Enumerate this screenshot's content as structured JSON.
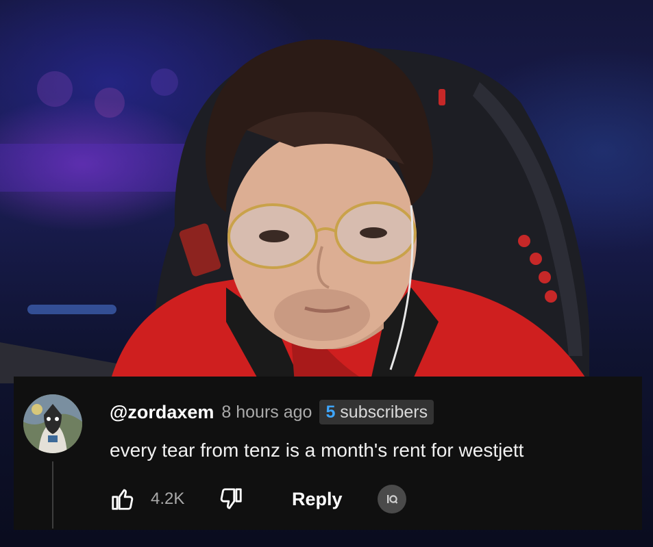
{
  "photo": {
    "description_icon": "streamer-photo",
    "accent_colors": [
      "#d32020",
      "#2a2f7a",
      "#8a3fd6"
    ]
  },
  "comment": {
    "avatar_icon": "user-avatar",
    "handle": "@zordaxem",
    "timestamp": "8 hours ago",
    "subscriber_count": "5",
    "subscriber_label": "subscribers",
    "text": "every tear from tenz is a month's rent for westjett",
    "like_icon": "thumbs-up-icon",
    "like_count": "4.2K",
    "dislike_icon": "thumbs-down-icon",
    "reply_label": "Reply",
    "extension_icon": "iq-icon",
    "colors": {
      "card_background": "#101010",
      "handle": "#ffffff",
      "muted": "#aaaaaa",
      "subscriber_count": "#3ea6ff",
      "badge_background": "#333333"
    }
  }
}
